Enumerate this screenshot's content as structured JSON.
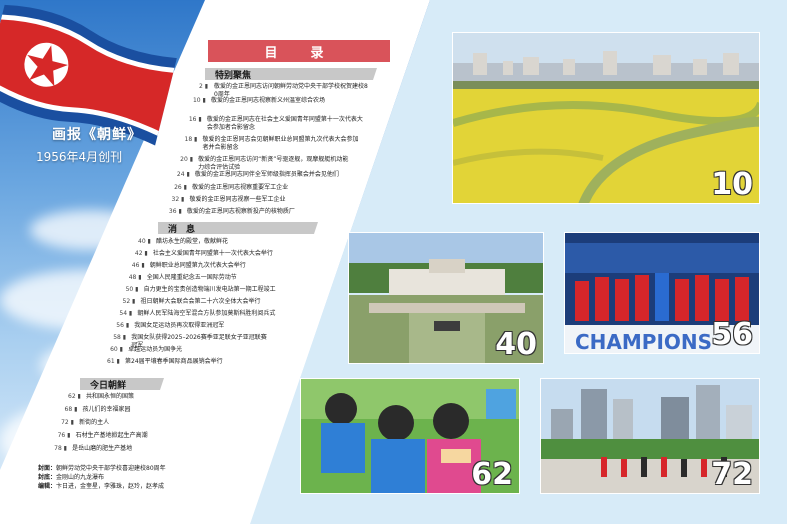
{
  "brand": {
    "name": "画报《朝鲜》",
    "founded": "1956年4月创刊"
  },
  "toc": {
    "title": "目　录",
    "sections": [
      {
        "heading": "特别聚焦",
        "items": [
          {
            "page": "2",
            "text": "敬爱的金正恩同志访问朝鲜劳动党中央干部学校祝贺建校80周年"
          },
          {
            "page": "10",
            "text": "敬爱的金正恩同志视察新义州温室综合农场"
          },
          {
            "page": "16",
            "text": "敬爱的金正恩同志在社会主义爱国青年同盟第十一次代表大会参加者合影留念"
          },
          {
            "page": "18",
            "text": "敬爱的金正恩同志会见朝鲜职业总同盟第九次代表大会参加者并合影留念"
          },
          {
            "page": "20",
            "text": "敬爱的金正恩同志访问“新贤”号驱逐舰，观摩舰艇机动能力综合评估试验"
          },
          {
            "page": "24",
            "text": "敬爱的金正恩同志同伴全军师级指挥员聚会并会见他们"
          },
          {
            "page": "26",
            "text": "敬爱的金正恩同志视察重要军工企业"
          },
          {
            "page": "32",
            "text": "敬爱的金正恩同志视察一些军工企业"
          },
          {
            "page": "36",
            "text": "敬爱的金正恩同志视察新投产的核物质厂"
          }
        ]
      },
      {
        "heading": "消　息",
        "items": [
          {
            "page": "40",
            "text": "醋坊永生的殿堂，敬献鲜花"
          },
          {
            "page": "42",
            "text": "社会主义爱国青年同盟第十一次代表大会举行"
          },
          {
            "page": "46",
            "text": "朝鲜职业总同盟第九次代表大会举行"
          },
          {
            "page": "48",
            "text": "全国人民隆重纪念五一国际劳动节"
          },
          {
            "page": "50",
            "text": "自力更生的宝贵创造物端川发电站第一期工程竣工"
          },
          {
            "page": "52",
            "text": "祖日朝鲜大会联合会第二十六次全体大会举行"
          },
          {
            "page": "54",
            "text": "朝鲜人民军陆海空军混合方队参加莫斯科胜利阅兵式"
          },
          {
            "page": "56",
            "text": "我国女足运动员再次取得亚洲冠军"
          },
          {
            "page": "58",
            "text": "我国女队获得2025–2026赛季亚足联女子亚冠联赛冠军"
          },
          {
            "page": "60",
            "text": "卓越运动员为国争光"
          },
          {
            "page": "61",
            "text": "第24届平壤春季国际商品展销会举行"
          }
        ]
      },
      {
        "heading": "今日朝鲜",
        "items": [
          {
            "page": "62",
            "text": "共和国永恒的国策"
          },
          {
            "page": "68",
            "text": "孩儿们的幸福家园"
          },
          {
            "page": "72",
            "text": "新街的主人"
          },
          {
            "page": "76",
            "text": "石材生产基地掀起生产高潮"
          },
          {
            "page": "78",
            "text": "是岳山磨的肥生产基地"
          }
        ]
      }
    ]
  },
  "footer": {
    "cover_label": "封面：",
    "cover_text": "朝鲜劳动党中央干部学校喜迎建校80周年",
    "back_label": "封底：",
    "back_text": "金刚山的九龙瀑布",
    "editor_label": "编辑：",
    "editor_text": "卞日进，金奎星，李雅珠，赵玲，赵孝成"
  },
  "photos": [
    {
      "page_label": "10"
    },
    {
      "page_label": "40"
    },
    {
      "page_label": "56"
    },
    {
      "page_label": "62"
    },
    {
      "page_label": "72"
    }
  ],
  "colors": {
    "title_bar": "#d9535a",
    "section_bar": "#c8c8c8",
    "flag_red": "#d62828",
    "flag_blue": "#1a4fa0"
  }
}
